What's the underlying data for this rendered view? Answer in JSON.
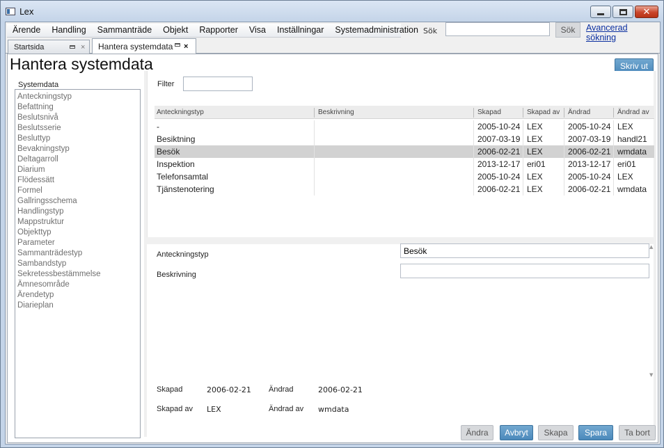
{
  "window": {
    "title": "Lex"
  },
  "menu": [
    "Ärende",
    "Handling",
    "Sammanträde",
    "Objekt",
    "Rapporter",
    "Visa",
    "Inställningar",
    "Systemadministration"
  ],
  "search": {
    "label": "Sök",
    "value": "",
    "button": "Sök",
    "advanced_link": "Avancerad sökning"
  },
  "tabs": [
    {
      "label": "Startsida"
    },
    {
      "label": "Hantera systemdata"
    }
  ],
  "page": {
    "title": "Hantera systemdata",
    "print_button": "Skriv ut"
  },
  "systemdata": {
    "legend": "Systemdata",
    "items": [
      "Anteckningstyp",
      "Befattning",
      "Beslutsnivå",
      "Beslutsserie",
      "Besluttyp",
      "Bevakningstyp",
      "Deltagarroll",
      "Diarium",
      "Flödessätt",
      "Formel",
      "Gallringsschema",
      "Handlingstyp",
      "Mappstruktur",
      "Objekttyp",
      "Parameter",
      "Sammanträdestyp",
      "Sambandstyp",
      "Sekretessbestämmelse",
      "Ämnesområde",
      "Ärendetyp",
      "Diarieplan"
    ]
  },
  "filter": {
    "label": "Filter",
    "value": ""
  },
  "grid": {
    "columns": [
      "Anteckningstyp",
      "Beskrivning",
      "Skapad",
      "Skapad av",
      "Ändrad",
      "Ändrad av"
    ],
    "rows": [
      [
        "-",
        "",
        "2005-10-24",
        "LEX",
        "2005-10-24",
        "LEX"
      ],
      [
        "Besiktning",
        "",
        "2007-03-19",
        "LEX",
        "2007-03-19",
        "handl21"
      ],
      [
        "Besök",
        "",
        "2006-02-21",
        "LEX",
        "2006-02-21",
        "wmdata"
      ],
      [
        "Inspektion",
        "",
        "2013-12-17",
        "eri01",
        "2013-12-17",
        "eri01"
      ],
      [
        "Telefonsamtal",
        "",
        "2005-10-24",
        "LEX",
        "2005-10-24",
        "LEX"
      ],
      [
        "Tjänstenotering",
        "",
        "2006-02-21",
        "LEX",
        "2006-02-21",
        "wmdata"
      ]
    ],
    "selected_row": 2
  },
  "detail": {
    "type_label": "Anteckningstyp",
    "type_value": "Besök",
    "desc_label": "Beskrivning",
    "desc_value": "",
    "created_label": "Skapad",
    "created_value": "2006-02-21",
    "changed_label": "Ändrad",
    "changed_value": "2006-02-21",
    "created_by_label": "Skapad av",
    "created_by_value": "LEX",
    "changed_by_label": "Ändrad av",
    "changed_by_value": "wmdata"
  },
  "buttons": {
    "edit": "Ändra",
    "cancel": "Avbryt",
    "create": "Skapa",
    "save": "Spara",
    "delete": "Ta bort"
  },
  "colors": {
    "accent_button": "#4b89bb",
    "selected_row": "#d2d2d2",
    "close_button": "#c9452b"
  }
}
